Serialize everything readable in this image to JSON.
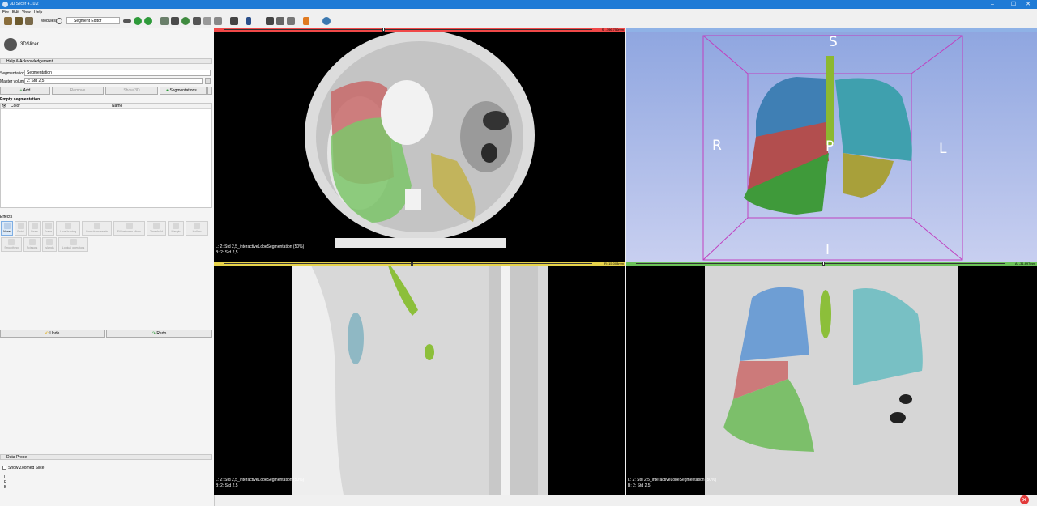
{
  "window": {
    "title": "3D Slicer 4.10.2",
    "controls": [
      "–",
      "☐",
      "✕"
    ]
  },
  "menu": [
    "File",
    "Edit",
    "View",
    "Help"
  ],
  "toolbar": {
    "modules_label": "Modules:",
    "module_selected": "Segment Editor"
  },
  "left_panel": {
    "logo_text": "3DSlicer",
    "help_section": "Help & Acknowledgement",
    "segmentation_label": "Segmentation:",
    "segmentation_value": "Segmentation",
    "master_label": "Master volume:",
    "master_value": "2: Std 2,5",
    "add_label": "Add",
    "remove_label": "Remove",
    "show3d_label": "Show 3D",
    "segmentations_label": "Segmentations...",
    "empty_label": "Empty segmentation",
    "table_headers": [
      "Color",
      "Name"
    ],
    "effects_label": "Effects",
    "effects": [
      "None",
      "Paint",
      "Draw",
      "Erase",
      "Level tracing",
      "Grow from seeds",
      "Fill between slices",
      "Threshold",
      "Margin",
      "Hollow",
      "Smoothing",
      "Scissors",
      "Islands",
      "Logical operators"
    ],
    "undo_label": "Undo",
    "redo_label": "Redo",
    "data_probe_label": "Data Probe",
    "show_zoomed_label": "Show Zoomed Slice",
    "probe_lines": [
      "L",
      "F",
      "B"
    ]
  },
  "views": {
    "red": {
      "value": "S: -196.750mm",
      "line1": "L: 2: Std 2,5_interactiveLobeSegmentation (50%)",
      "line2": "B: 2: Std 2,5",
      "color": "#f04848"
    },
    "three_d": {
      "labels": {
        "s": "S",
        "r": "R",
        "l": "L",
        "p": "P",
        "i": "I"
      },
      "color": "#8fb2e6"
    },
    "yellow": {
      "value": "R: 15.003mm",
      "line1": "L: 2: Std 2,5_interactiveLobeSegmentation (50%)",
      "line2": "B: 2: Std 2,5",
      "color": "#e6d24a"
    },
    "green": {
      "value": "A: -31.897mm",
      "line1": "L: 2: Std 2,5_interactiveLobeSegmentation (50%)",
      "line2": "B: 2: Std 2,5",
      "color": "#6cc35a"
    }
  }
}
